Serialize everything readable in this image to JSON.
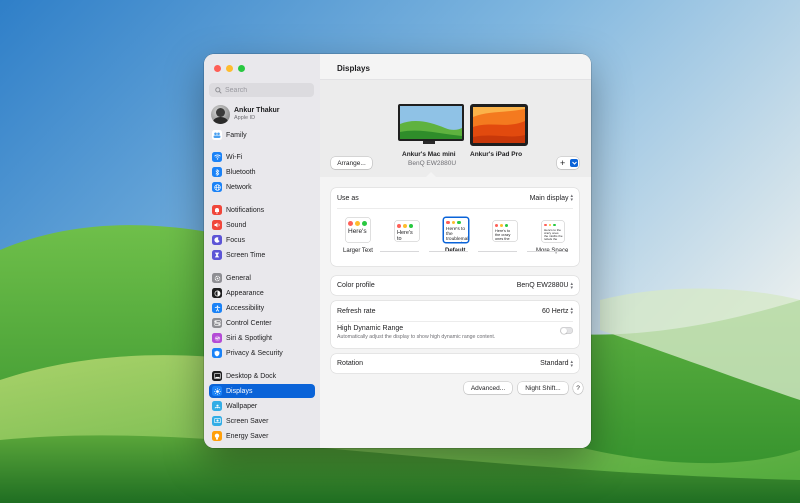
{
  "sidebar": {
    "search_placeholder": "Search",
    "account": {
      "name": "Ankur Thakur",
      "subtitle": "Apple ID"
    },
    "items": [
      {
        "label": "Family",
        "icon": "family-icon",
        "color": "#ffffff"
      },
      {
        "label": "Wi-Fi",
        "icon": "wifi-icon",
        "color": "#1a82f7"
      },
      {
        "label": "Bluetooth",
        "icon": "bluetooth-icon",
        "color": "#1a82f7"
      },
      {
        "label": "Network",
        "icon": "network-icon",
        "color": "#1a82f7"
      },
      {
        "label": "Notifications",
        "icon": "notifications-icon",
        "color": "#f0473b"
      },
      {
        "label": "Sound",
        "icon": "sound-icon",
        "color": "#f0473b"
      },
      {
        "label": "Focus",
        "icon": "focus-icon",
        "color": "#5d55d6"
      },
      {
        "label": "Screen Time",
        "icon": "screen-time-icon",
        "color": "#5d55d6"
      },
      {
        "label": "General",
        "icon": "general-icon",
        "color": "#8e8e93"
      },
      {
        "label": "Appearance",
        "icon": "appearance-icon",
        "color": "#1d1d1f"
      },
      {
        "label": "Accessibility",
        "icon": "accessibility-icon",
        "color": "#1a82f7"
      },
      {
        "label": "Control Center",
        "icon": "control-center-icon",
        "color": "#8e8e93"
      },
      {
        "label": "Siri & Spotlight",
        "icon": "siri-icon",
        "color": "#b44bd6"
      },
      {
        "label": "Privacy & Security",
        "icon": "privacy-icon",
        "color": "#1a82f7"
      },
      {
        "label": "Desktop & Dock",
        "icon": "desktop-dock-icon",
        "color": "#1d1d1f"
      },
      {
        "label": "Displays",
        "icon": "displays-icon",
        "color": "#1a82f7",
        "active": true
      },
      {
        "label": "Wallpaper",
        "icon": "wallpaper-icon",
        "color": "#32ade6"
      },
      {
        "label": "Screen Saver",
        "icon": "screen-saver-icon",
        "color": "#32ade6"
      },
      {
        "label": "Energy Saver",
        "icon": "energy-saver-icon",
        "color": "#ff9f0a"
      }
    ]
  },
  "main": {
    "title": "Displays",
    "arrange_button": "Arrange...",
    "add_button": "+",
    "displays": [
      {
        "name": "Ankur's Mac mini",
        "model": "BenQ EW2880U"
      },
      {
        "name": "Ankur's iPad Pro"
      }
    ],
    "use_as": {
      "label": "Use as",
      "value": "Main display"
    },
    "resolution_options": [
      {
        "label": "Larger Text",
        "sample": "Here's"
      },
      {
        "label": "",
        "sample": "Here's to troubleman"
      },
      {
        "label": "Default",
        "sample": "Here's to the troublemakers ones who see"
      },
      {
        "label": "",
        "sample": "Here's to the crazy ones the troublemakers. The ones who see things differently"
      },
      {
        "label": "More Space",
        "sample": "Here's to the crazy ones the misfits the rebels the troublemakers the round pegs in the square holes"
      }
    ],
    "color_profile": {
      "label": "Color profile",
      "value": "BenQ EW2880U"
    },
    "refresh_rate": {
      "label": "Refresh rate",
      "value": "60 Hertz"
    },
    "hdr": {
      "label": "High Dynamic Range",
      "description": "Automatically adjust the display to show high dynamic range content.",
      "enabled": false
    },
    "rotation": {
      "label": "Rotation",
      "value": "Standard"
    },
    "buttons": {
      "advanced": "Advanced...",
      "night_shift": "Night Shift...",
      "help": "?"
    }
  },
  "colors": {
    "accent": "#0a63d8",
    "close": "#fe5f57",
    "minimize": "#febc2e",
    "zoom": "#28c840"
  }
}
